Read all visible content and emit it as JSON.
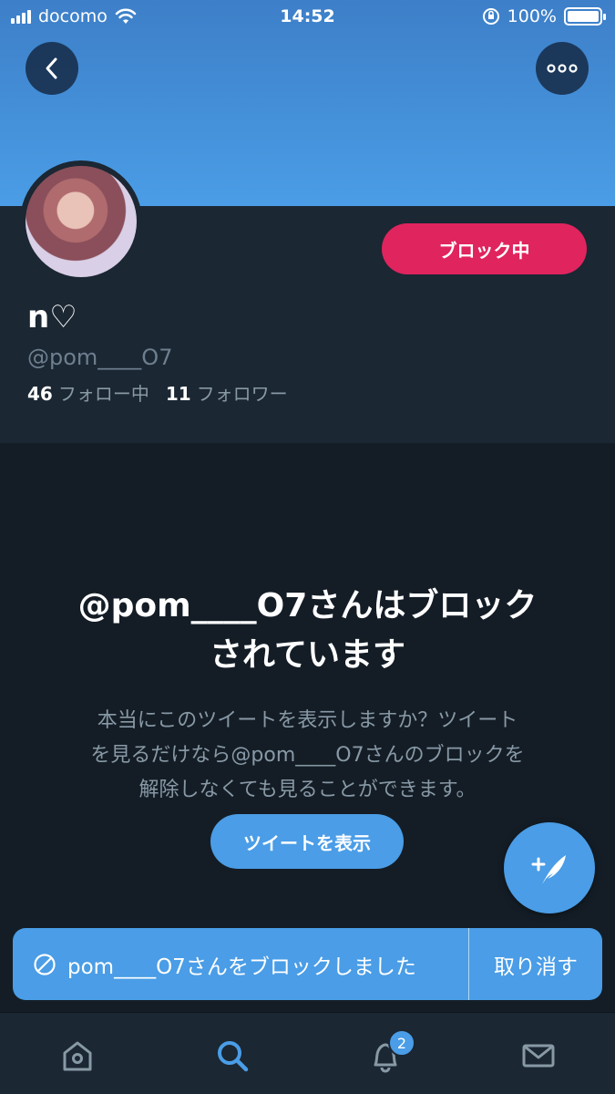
{
  "status_bar": {
    "carrier": "docomo",
    "time": "14:52",
    "battery": "100%"
  },
  "profile": {
    "display_name": "n♡",
    "handle": "@pom____O7",
    "block_button": "ブロック中",
    "following_count": "46",
    "following_label": "フォロー中",
    "followers_count": "11",
    "followers_label": "フォロワー"
  },
  "blocked_notice": {
    "title_line1": "@pom____O7さんはブロック",
    "title_line2": "されています",
    "desc_line1": "本当にこのツイートを表示しますか？ツイート",
    "desc_line2": "を見るだけなら@pom____O7さんのブロックを",
    "desc_line3": "解除しなくても見ることができます。",
    "show_button": "ツイートを表示"
  },
  "toast": {
    "message": "pom____O7さんをブロックしました",
    "undo": "取り消す"
  },
  "tabbar": {
    "notif_badge": "2",
    "active_tab": "search"
  },
  "colors": {
    "accent": "#4a9de6",
    "block_red": "#e0245e",
    "background": "#141d26",
    "panel": "#1b2733"
  }
}
